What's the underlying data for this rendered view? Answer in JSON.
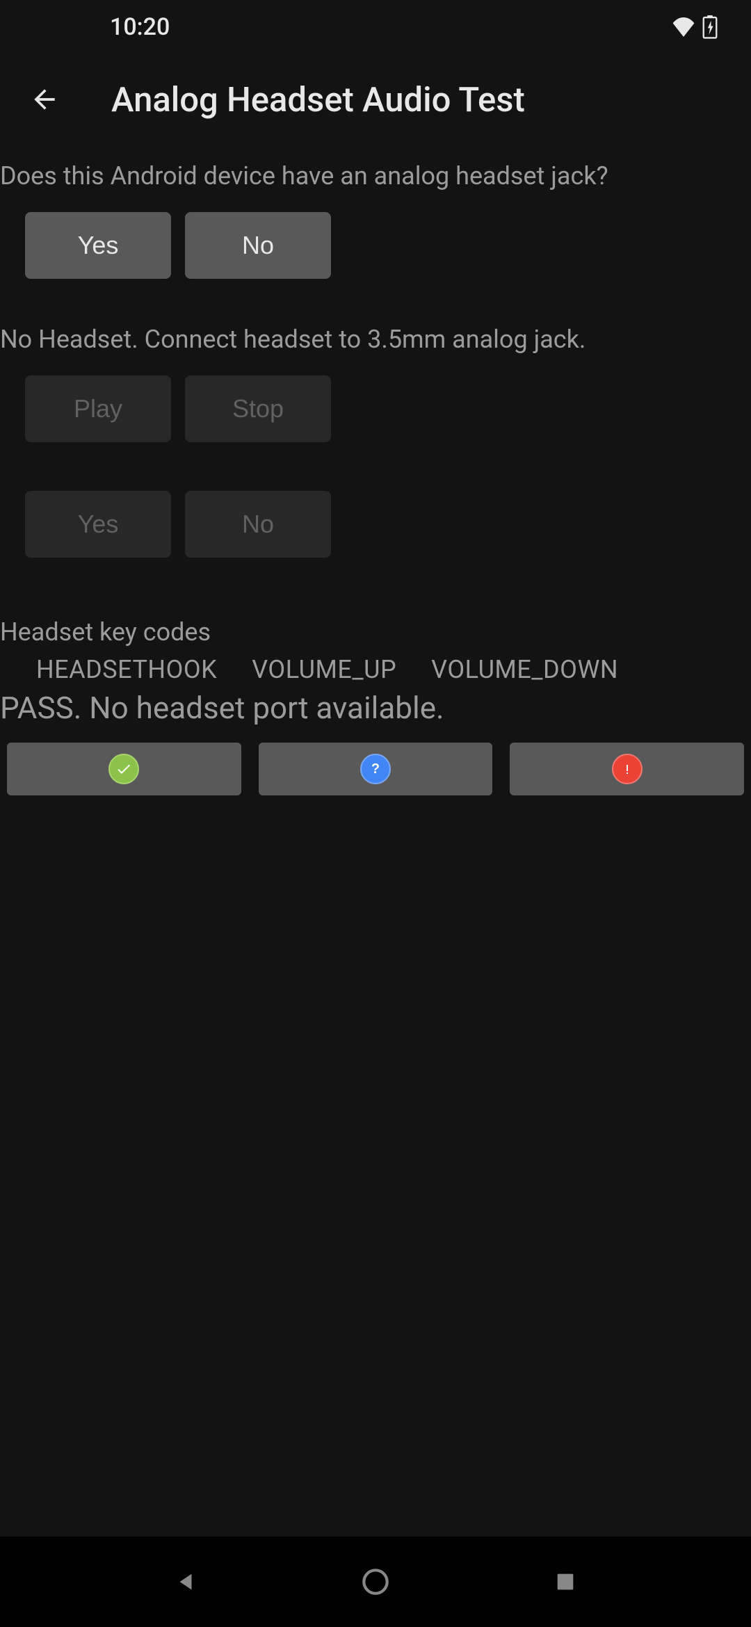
{
  "status_bar": {
    "time": "10:20"
  },
  "app_bar": {
    "title": "Analog Headset Audio Test"
  },
  "content": {
    "question": "Does this Android device have an analog headset jack?",
    "yes_label": "Yes",
    "no_label": "No",
    "headset_status": "No Headset. Connect headset to 3.5mm analog jack.",
    "play_label": "Play",
    "stop_label": "Stop",
    "yes2_label": "Yes",
    "no2_label": "No",
    "keycodes_header": "Headset key codes",
    "keycodes": {
      "headsethook": "HEADSETHOOK",
      "volume_up": "VOLUME_UP",
      "volume_down": "VOLUME_DOWN"
    },
    "pass_message": "PASS. No headset port available."
  }
}
